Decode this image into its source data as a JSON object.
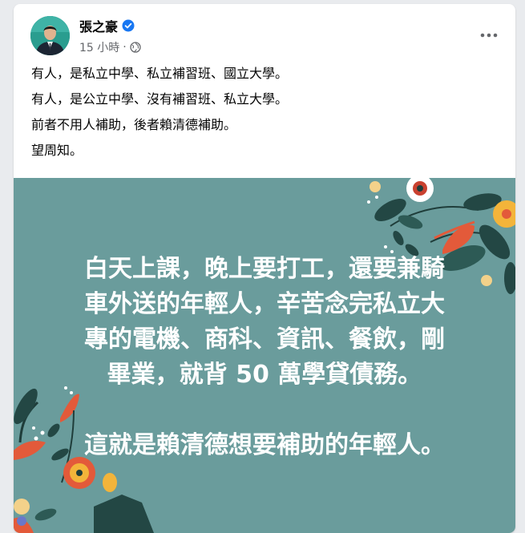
{
  "post": {
    "author": "張之豪",
    "time": "15 小時",
    "separator": "·",
    "lines": [
      "有人，是私立中學、私立補習班、國立大學。",
      "有人，是公立中學、沒有補習班、私立大學。",
      "前者不用人補助，後者賴清德補助。",
      "望周知。"
    ]
  },
  "image": {
    "lines": [
      "白天上課，晚上要打工，還要兼騎",
      "車外送的年輕人，辛苦念完私立大",
      "專的電機、商科、資訊、餐飲，剛",
      "畢業，就背 50 萬學貸債務。"
    ],
    "closing": "這就是賴清德想要補助的年輕人。"
  },
  "colors": {
    "verified": "#1877f2",
    "image_background": "#6a9c9c"
  },
  "icons": {
    "verified": "verified-badge-icon",
    "privacy": "globe-icon",
    "more": "more-dots-icon"
  }
}
